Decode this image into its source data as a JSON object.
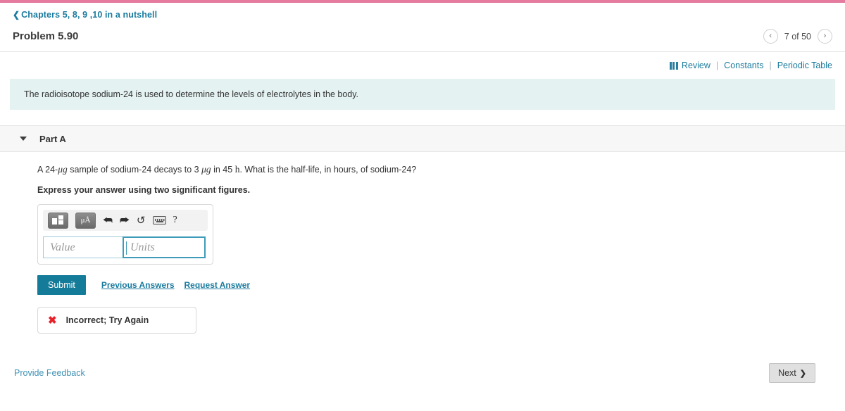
{
  "theme": {
    "accent_pink": "#e47a9e",
    "link_teal": "#1a7b9e",
    "submit_teal": "#147b98",
    "banner_bg": "#e4f2f1",
    "error_red": "#e8202a"
  },
  "breadcrumb": {
    "back_icon": "chevron-left-icon",
    "label": "Chapters 5, 8, 9 ,10 in a nutshell"
  },
  "header": {
    "title": "Problem 5.90",
    "pager": {
      "prev_icon": "‹",
      "next_icon": "›",
      "count_label": "7 of 50"
    }
  },
  "utility": {
    "review_icon": "book-icon",
    "review_label": "Review",
    "separator": "|",
    "constants_label": "Constants",
    "periodic_table_label": "Periodic Table"
  },
  "info_banner": {
    "text": "The radioisotope sodium-24 is used to determine the levels of electrolytes in the body."
  },
  "part": {
    "caret_icon": "caret-down-icon",
    "label": "Part A",
    "question": {
      "seg1": "A 24-",
      "unit1": "μg",
      "seg2": " sample of sodium-24 decays to 3 ",
      "unit2": "μg",
      "seg3": " in 45 ",
      "unit3": "h",
      "seg4": ". What is the half-life, in hours, of sodium-24?"
    },
    "instruction": "Express your answer using two significant figures."
  },
  "answer_widget": {
    "toolbar": {
      "template_button": "template-icon",
      "units_button_label": "μÅ",
      "undo_icon": "⮪",
      "redo_icon": "⮫",
      "reset_icon": "↺",
      "keyboard_icon": "keyboard-icon",
      "help_icon": "?"
    },
    "value_placeholder": "Value",
    "units_placeholder": "Units",
    "value_current": "",
    "units_current": ""
  },
  "actions": {
    "submit_label": "Submit",
    "previous_answers_label": "Previous Answers",
    "request_answer_label": "Request Answer"
  },
  "feedback": {
    "status_icon": "✖",
    "status_text": "Incorrect; Try Again"
  },
  "footer": {
    "provide_feedback_label": "Provide Feedback",
    "next_label": "Next",
    "next_chevron": "❯"
  }
}
